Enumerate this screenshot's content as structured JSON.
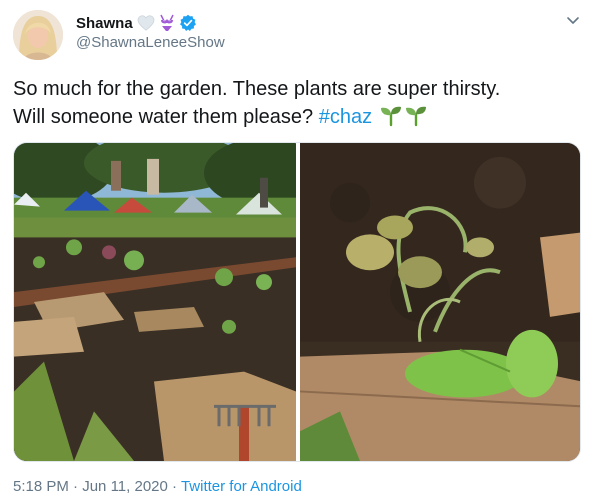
{
  "author": {
    "display_name": "Shawna",
    "handle": "@ShawnaLeneeShow",
    "badges": [
      "white-heart-icon",
      "bikini-icon",
      "verified-badge-icon"
    ]
  },
  "tweet": {
    "text_line1": "So much for the garden. These plants are super thirsty.",
    "text_line2_prefix": "Will someone water them please? ",
    "hashtag": "#chaz",
    "emojis": [
      "seedling-icon",
      "seedling-icon"
    ]
  },
  "media": {
    "photos": [
      "garden-photo",
      "wilted-basil-photo"
    ]
  },
  "footer": {
    "time": "5:18 PM",
    "separator": "·",
    "date": "Jun 11, 2020",
    "source": "Twitter for Android"
  },
  "colors": {
    "link": "#1b95e0",
    "verified": "#1da1f2",
    "secondary_text": "#657786"
  }
}
